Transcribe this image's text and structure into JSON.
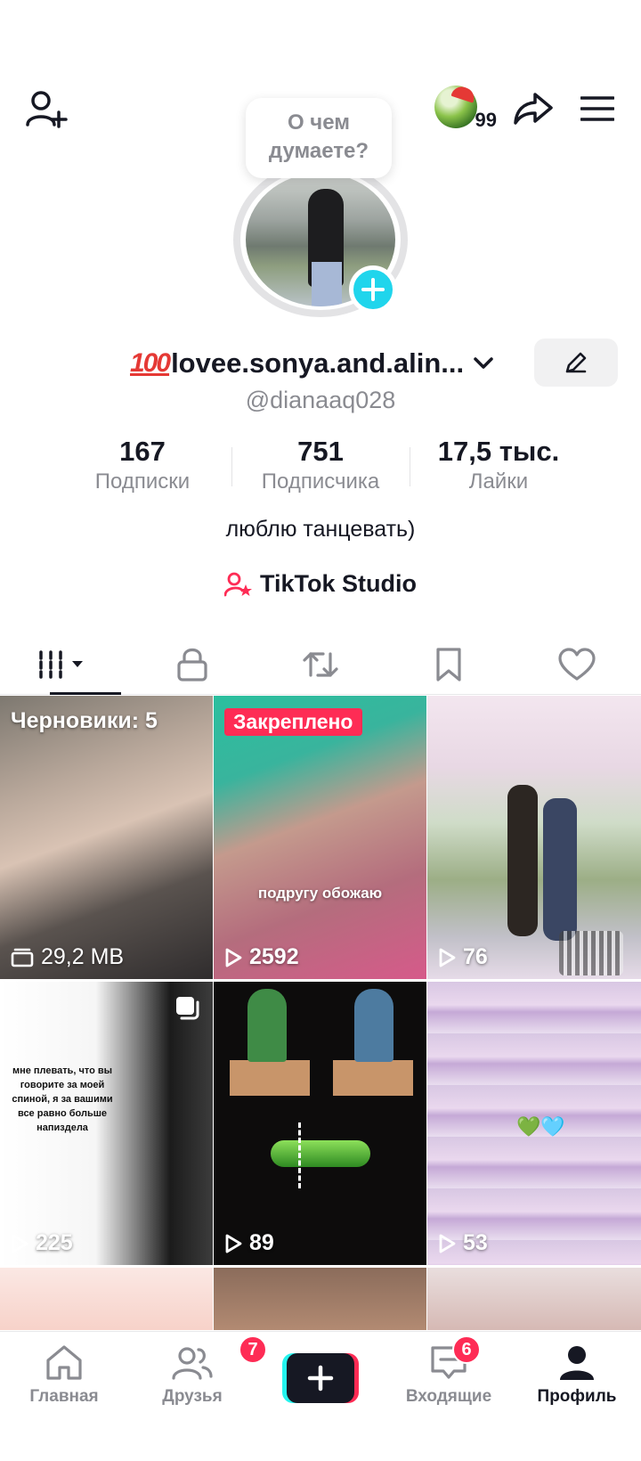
{
  "top_bar": {
    "notification_count": "99"
  },
  "thought_bubble": {
    "text_line1": "О чем",
    "text_line2": "думаете?"
  },
  "profile": {
    "name_emoji": "100",
    "display_name": "lovee.sonya.and.alin...",
    "handle": "@dianaaq028",
    "bio": "люблю танцевать)",
    "studio_label": "TikTok Studio"
  },
  "stats": [
    {
      "value": "167",
      "label": "Подписки"
    },
    {
      "value": "751",
      "label": "Подписчика"
    },
    {
      "value": "17,5 тыс.",
      "label": "Лайки"
    }
  ],
  "videos": [
    {
      "tag": "Черновики: 5",
      "meta": "29,2 MB"
    },
    {
      "tag": "Закреплено",
      "caption": "подругу обожаю",
      "views": "2592"
    },
    {
      "views": "76"
    },
    {
      "quote": "мне плевать, что вы говорите за моей спиной, я за вашими все равно больше напиздела",
      "views": "225"
    },
    {
      "views": "89"
    },
    {
      "emoji": "💚🩵",
      "views": "53"
    }
  ],
  "bottom_nav": {
    "home": "Главная",
    "friends": "Друзья",
    "friends_badge": "7",
    "inbox": "Входящие",
    "inbox_badge": "6",
    "profile": "Профиль"
  },
  "colors": {
    "accent_pink": "#fe2c55",
    "accent_cyan": "#20d5ec",
    "text_primary": "#161823",
    "text_secondary": "#8a8b91"
  }
}
